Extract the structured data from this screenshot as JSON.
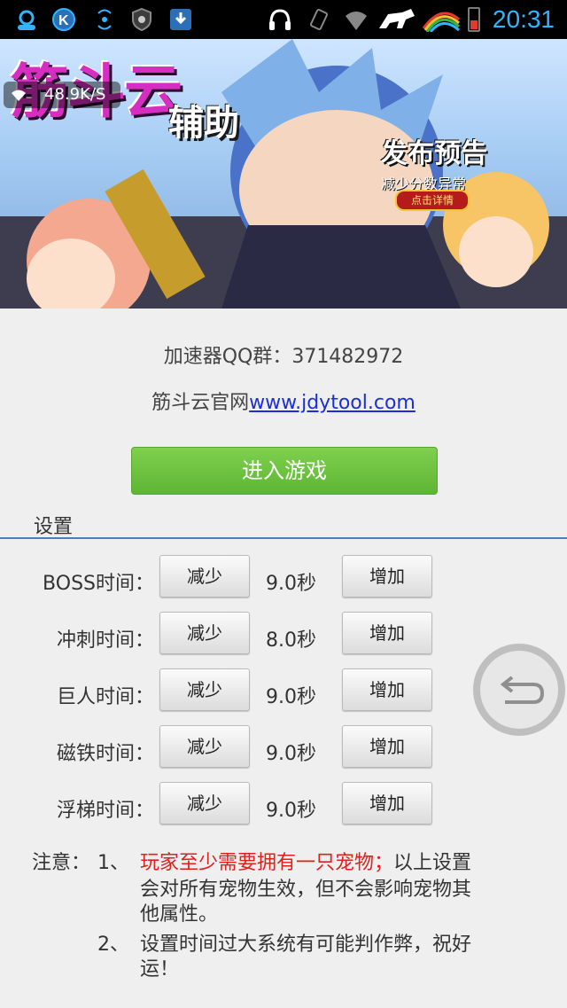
{
  "status_bar": {
    "time": "20:31"
  },
  "banner": {
    "title_main": "筋斗云",
    "title_sub": "辅助",
    "net_speed": "48.9K/S",
    "notice_title": "发布预告",
    "notice_sub": "减少分数异常",
    "notice_btn": "点击详情"
  },
  "info": {
    "qq_group": "加速器QQ群：371482972",
    "site_prefix": "筋斗云官网",
    "site_link": "www.jdytool.com"
  },
  "enter_button": "进入游戏",
  "settings": {
    "title": "设置",
    "dec_label": "减少",
    "inc_label": "增加",
    "rows": [
      {
        "label": "BOSS时间：",
        "value": "9.0秒"
      },
      {
        "label": "冲刺时间：",
        "value": "8.0秒"
      },
      {
        "label": "巨人时间：",
        "value": "9.0秒"
      },
      {
        "label": "磁铁时间：",
        "value": "9.0秒"
      },
      {
        "label": "浮梯时间：",
        "value": "9.0秒"
      }
    ]
  },
  "notes": {
    "prefix": "注意：",
    "n1_num": "1、",
    "n1_red": "玩家至少需要拥有一只宠物；",
    "n1_rest_line1": "以上设置",
    "n1_line2": "会对所有宠物生效，但不会影响宠物其",
    "n1_line3": "他属性。",
    "n2_num": "2、",
    "n2_line1": "设置时间过大系统有可能判作弊，祝好",
    "n2_line2": "运！"
  },
  "icons": {
    "status": [
      "headset-person-icon",
      "k-app-icon",
      "wifi-signal-icon",
      "shield-icon",
      "download-icon",
      "headphones-icon",
      "vibrate-icon",
      "wifi-icon",
      "horse-app-icon",
      "rainbow-app-icon",
      "battery-icon"
    ],
    "back_float": "back-arrow-icon"
  },
  "colors": {
    "accent_green": "#5db634",
    "link_blue": "#1a2fd8",
    "warning_red": "#e0201d",
    "divider_blue": "#4a7fb8"
  }
}
